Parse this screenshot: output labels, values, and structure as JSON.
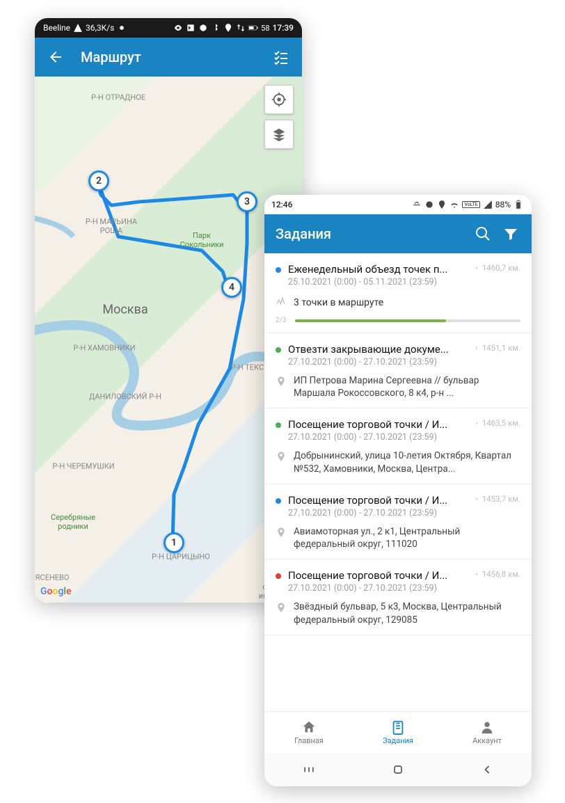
{
  "left": {
    "status": {
      "carrier": "Beeline",
      "speed": "36,3K/s",
      "time": "17:39",
      "battery": "58"
    },
    "appbar": {
      "title": "Маршрут"
    },
    "map": {
      "city": "Москва",
      "districts": [
        "Р-Н ОТРАДНОЕ",
        "Р-Н МАРЬИНА\nРОЩА",
        "Р-Н ХАМОВНИКИ",
        "ДАНИЛОВСКИЙ Р-Н",
        "Р-Н ТЕКСТИЛЬ",
        "Р-Н ЧЕРЕМУШКИ",
        "Р-Н ЦАРИЦЫНО",
        "ЯСЕНЕВО"
      ],
      "park": "Парк\nСокольники",
      "landmarks": [
        "Серебряные\nродники",
        "совхоз\nим. Лени",
        "Google"
      ],
      "markers": [
        "1",
        "2",
        "3",
        "4"
      ],
      "attribution": "Google"
    }
  },
  "right": {
    "status": {
      "time": "12:46",
      "battery_pct": "88%"
    },
    "appbar": {
      "title": "Задания"
    },
    "tasks": [
      {
        "color": "blue",
        "title": "Еженедельный объезд точек п...",
        "date_range": "25.10.2021 (0:00) - 05.11.2021 (23:59)",
        "dist": "1460,7 км.",
        "route_text": "3 точки в маршруте",
        "progress_label": "2/3",
        "progress_pct": 67
      },
      {
        "color": "green",
        "title": "Отвезти закрывающие докуме...",
        "date_range": "27.10.2021 (0:00) - 27.10.2021 (23:59)",
        "dist": "1451,1 км.",
        "address": "ИП Петрова Марина Сергеевна  //  бульвар Маршала Рокоссовского, 8 к4, р-н ..."
      },
      {
        "color": "green",
        "title": "Посещение торговой точки / И...",
        "date_range": "27.10.2021 (0:00) - 27.10.2021 (23:59)",
        "dist": "1463,5 км.",
        "address": "Добрынинский, улица 10-летия Октября, Квартал №532, Хамовники, Москва, Центра..."
      },
      {
        "color": "blue",
        "title": "Посещение торговой точки / И...",
        "date_range": "27.10.2021 (0:00) - 27.10.2021 (23:59)",
        "dist": "1453,7 км.",
        "address": "Авиамоторная ул., 2 к1, Центральный федеральный округ, 111020"
      },
      {
        "color": "red",
        "title": "Посещение торговой точки / И...",
        "date_range": "27.10.2021 (0:00) - 27.10.2021 (23:59)",
        "dist": "1456,8 км.",
        "address": "Звёздный бульвар, 5 к3, Москва, Центральный федеральный округ, 129085"
      }
    ],
    "bottom_nav": {
      "home": "Главная",
      "tasks": "Задания",
      "account": "Аккаунт"
    }
  }
}
